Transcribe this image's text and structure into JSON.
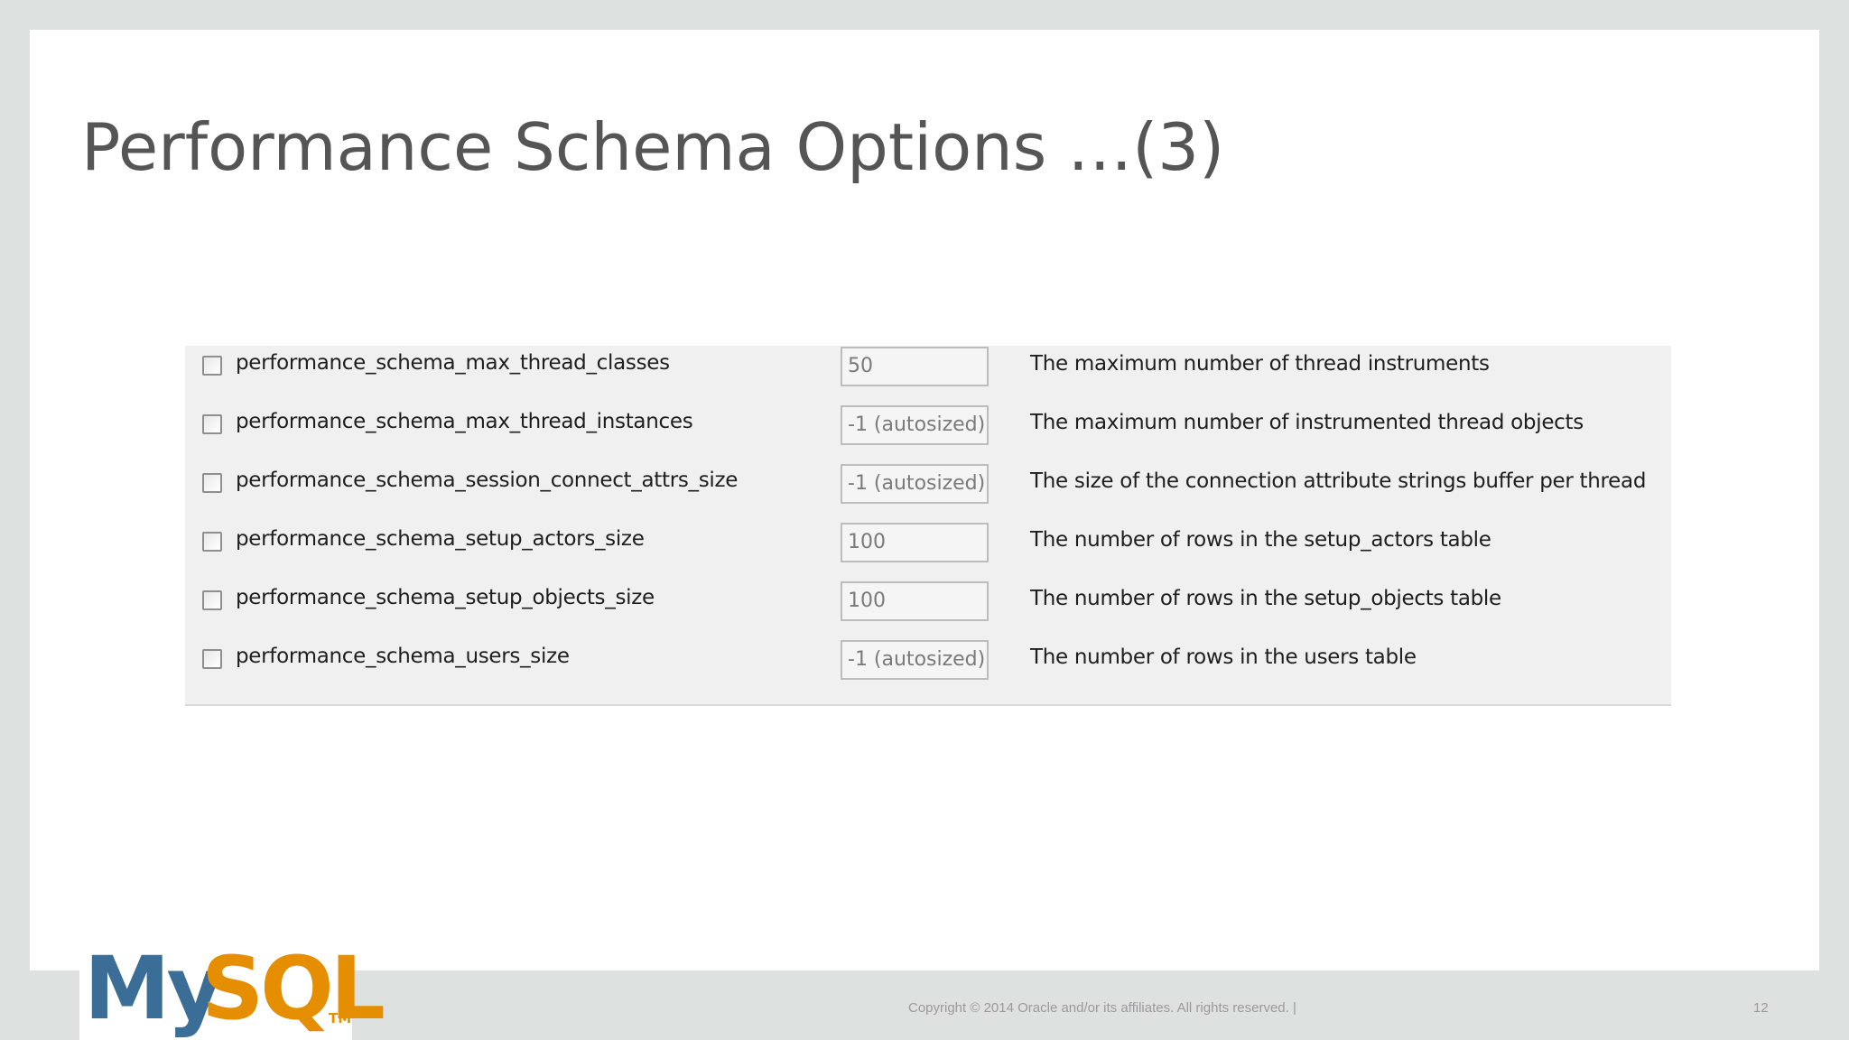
{
  "slide": {
    "title": "Performance Schema Options …(3)"
  },
  "options": [
    {
      "name": "performance_schema_max_thread_classes",
      "value": "50",
      "description": "The maximum number of thread instruments",
      "checked": false
    },
    {
      "name": "performance_schema_max_thread_instances",
      "value": "-1 (autosized)",
      "description": "The maximum number of instrumented thread objects",
      "checked": false
    },
    {
      "name": "performance_schema_session_connect_attrs_size",
      "value": "-1 (autosized)",
      "description": "The size of the connection attribute strings buffer per thread",
      "checked": false
    },
    {
      "name": "performance_schema_setup_actors_size",
      "value": "100",
      "description": "The number of rows in the setup_actors table",
      "checked": false
    },
    {
      "name": "performance_schema_setup_objects_size",
      "value": "100",
      "description": "The number of rows in the setup_objects table",
      "checked": false
    },
    {
      "name": "performance_schema_users_size",
      "value": "-1 (autosized)",
      "description": "The number of rows in the users table",
      "checked": false
    }
  ],
  "footer": {
    "logo": {
      "my": "My",
      "sql": "SQL",
      "tm": "TM"
    },
    "copyright": "Copyright © 2014 Oracle and/or its affiliates. All rights reserved.  |",
    "page_number": "12"
  },
  "colors": {
    "background": "#dde2e1",
    "slide": "#ffffff",
    "panel": "#f0f0f0",
    "title": "#555555",
    "logo_blue": "#3b6e97",
    "logo_orange": "#e48e00"
  }
}
